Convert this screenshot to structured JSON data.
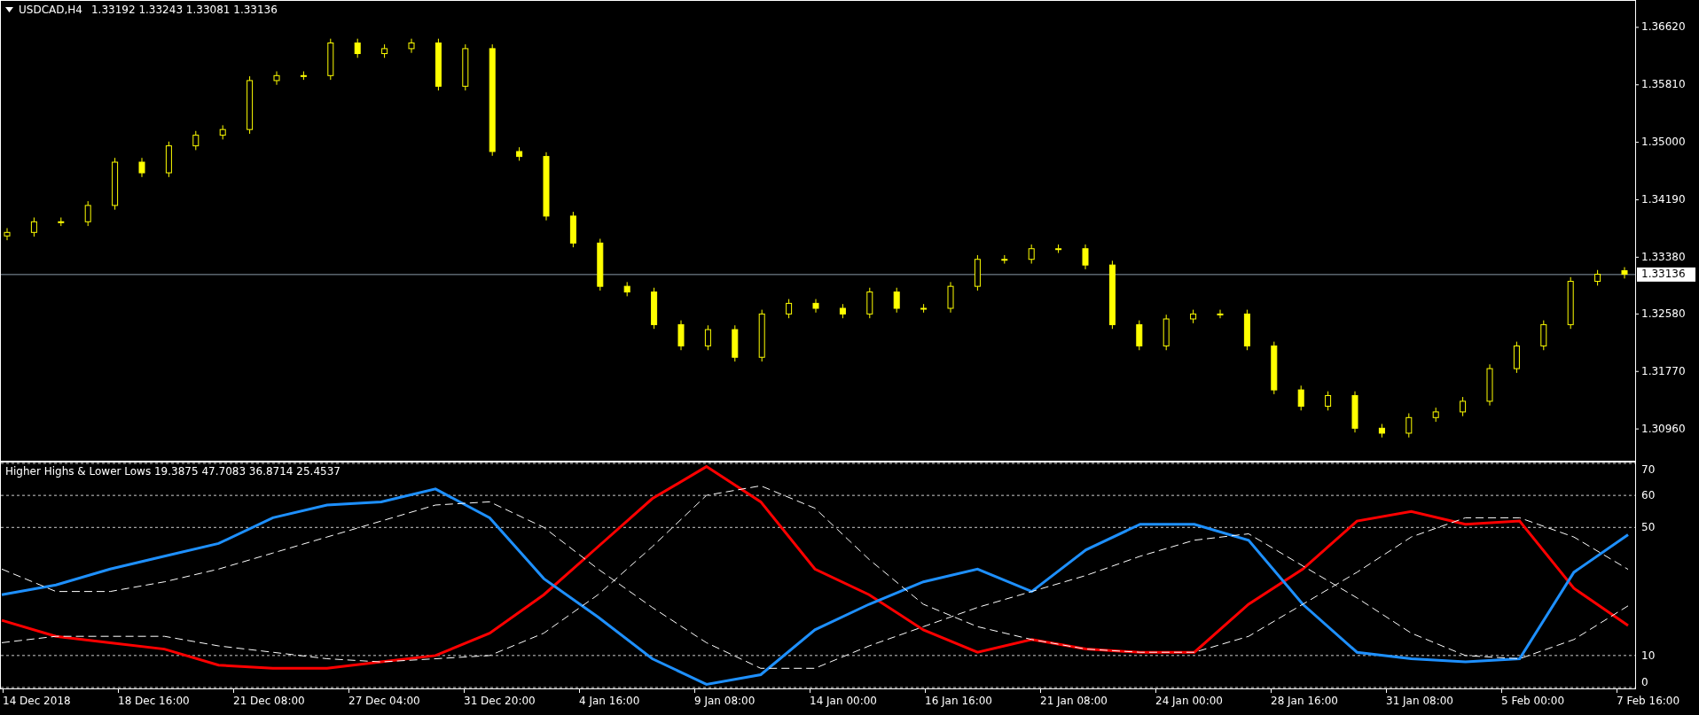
{
  "price_panel": {
    "symbol": "USDCAD,H4",
    "quote": "1.33192 1.33243 1.33081 1.33136",
    "chart_data": {
      "type": "candlestick",
      "ylim": [
        1.30537,
        1.36968
      ],
      "yticks": [
        {
          "value": 1.3662,
          "label": "1.36620"
        },
        {
          "value": 1.3581,
          "label": "1.35810"
        },
        {
          "value": 1.35,
          "label": "1.35000"
        },
        {
          "value": 1.3419,
          "label": "1.34190"
        },
        {
          "value": 1.3338,
          "label": "1.33380"
        },
        {
          "value": 1.3258,
          "label": "1.32580"
        },
        {
          "value": 1.3177,
          "label": "1.31770"
        },
        {
          "value": 1.3096,
          "label": "1.30960"
        }
      ],
      "ref_lines": [
        {
          "axis": "y",
          "value": 1.33136,
          "label": "1.33136",
          "color": "#8a9aa8"
        }
      ],
      "color": "#ffff00",
      "categories": [
        null,
        null,
        null,
        null,
        null,
        null,
        null,
        null,
        null,
        null,
        null,
        null,
        null,
        null,
        null,
        null,
        null,
        null,
        null,
        null,
        null,
        null,
        null,
        null,
        null,
        null,
        null,
        null,
        null,
        null,
        null,
        null,
        null,
        null,
        null,
        null,
        null,
        null,
        null,
        null,
        null,
        null,
        null,
        null,
        null,
        null,
        null,
        null,
        null,
        null,
        null,
        null,
        null,
        null,
        null,
        null,
        null,
        null,
        null,
        null,
        null
      ],
      "ohlc": [
        [
          1.3368,
          1.3379,
          1.3362,
          1.3373
        ],
        [
          1.3373,
          1.3394,
          1.3367,
          1.3388
        ],
        [
          1.3388,
          1.3394,
          1.3382,
          1.3388
        ],
        [
          1.3388,
          1.3417,
          1.3382,
          1.3411
        ],
        [
          1.3411,
          1.3478,
          1.3405,
          1.3472
        ],
        [
          1.3472,
          1.3478,
          1.3451,
          1.3457
        ],
        [
          1.3457,
          1.3501,
          1.3451,
          1.3495
        ],
        [
          1.3495,
          1.3516,
          1.3489,
          1.351
        ],
        [
          1.351,
          1.3524,
          1.3504,
          1.3518
        ],
        [
          1.3518,
          1.3593,
          1.3512,
          1.3587
        ],
        [
          1.3587,
          1.36,
          1.3581,
          1.3594
        ],
        [
          1.3594,
          1.36,
          1.3588,
          1.3594
        ],
        [
          1.3594,
          1.3646,
          1.3588,
          1.364
        ],
        [
          1.364,
          1.3646,
          1.3619,
          1.3625
        ],
        [
          1.3625,
          1.3638,
          1.3619,
          1.3632
        ],
        [
          1.3632,
          1.3646,
          1.3626,
          1.364
        ],
        [
          1.364,
          1.3646,
          1.3573,
          1.3579
        ],
        [
          1.3579,
          1.3638,
          1.3573,
          1.3632
        ],
        [
          1.3632,
          1.3638,
          1.3481,
          1.3487
        ],
        [
          1.3487,
          1.3493,
          1.3474,
          1.348
        ],
        [
          1.348,
          1.3486,
          1.339,
          1.3396
        ],
        [
          1.3396,
          1.3402,
          1.3352,
          1.3358
        ],
        [
          1.3358,
          1.3364,
          1.3291,
          1.3297
        ],
        [
          1.3297,
          1.3303,
          1.3283,
          1.3289
        ],
        [
          1.3289,
          1.3295,
          1.3237,
          1.3243
        ],
        [
          1.3243,
          1.3249,
          1.3207,
          1.3213
        ],
        [
          1.3213,
          1.3242,
          1.3207,
          1.3236
        ],
        [
          1.3236,
          1.3242,
          1.3191,
          1.3197
        ],
        [
          1.3197,
          1.3264,
          1.3191,
          1.3258
        ],
        [
          1.3258,
          1.3279,
          1.3252,
          1.3273
        ],
        [
          1.3273,
          1.3279,
          1.326,
          1.3266
        ],
        [
          1.3266,
          1.3272,
          1.3252,
          1.3258
        ],
        [
          1.3258,
          1.3295,
          1.3252,
          1.3289
        ],
        [
          1.3289,
          1.3295,
          1.326,
          1.3266
        ],
        [
          1.3266,
          1.3272,
          1.326,
          1.3266
        ],
        [
          1.3266,
          1.3303,
          1.326,
          1.3297
        ],
        [
          1.3297,
          1.3341,
          1.3291,
          1.3335
        ],
        [
          1.3335,
          1.3341,
          1.3329,
          1.3335
        ],
        [
          1.3335,
          1.3356,
          1.3329,
          1.335
        ],
        [
          1.335,
          1.3356,
          1.3344,
          1.335
        ],
        [
          1.335,
          1.3356,
          1.3321,
          1.3327
        ],
        [
          1.3327,
          1.3333,
          1.3237,
          1.3243
        ],
        [
          1.3243,
          1.3249,
          1.3207,
          1.3213
        ],
        [
          1.3213,
          1.3257,
          1.3207,
          1.3251
        ],
        [
          1.3251,
          1.3264,
          1.3245,
          1.3258
        ],
        [
          1.3258,
          1.3264,
          1.3252,
          1.3258
        ],
        [
          1.3258,
          1.3264,
          1.3207,
          1.3213
        ],
        [
          1.3213,
          1.3219,
          1.3145,
          1.3151
        ],
        [
          1.3151,
          1.3157,
          1.3122,
          1.3128
        ],
        [
          1.3128,
          1.3149,
          1.3122,
          1.3143
        ],
        [
          1.3143,
          1.3149,
          1.3091,
          1.3097
        ],
        [
          1.3097,
          1.3103,
          1.3084,
          1.309
        ],
        [
          1.309,
          1.3118,
          1.3084,
          1.3112
        ],
        [
          1.3112,
          1.3126,
          1.3106,
          1.312
        ],
        [
          1.312,
          1.3141,
          1.3114,
          1.3135
        ],
        [
          1.3135,
          1.3187,
          1.3129,
          1.3181
        ],
        [
          1.3181,
          1.3219,
          1.3175,
          1.3213
        ],
        [
          1.3213,
          1.3249,
          1.3207,
          1.3243
        ],
        [
          1.3243,
          1.331,
          1.3237,
          1.3304
        ],
        [
          1.3304,
          1.332,
          1.3298,
          1.3314
        ],
        [
          1.3319,
          1.3324,
          1.3308,
          1.3314
        ]
      ]
    }
  },
  "indicator_panel": {
    "title": "Higher Highs & Lower Lows 19.3875 47.7083 36.8714 25.4537",
    "chart_data": {
      "type": "line",
      "ylim": [
        0,
        70
      ],
      "yticks": [
        70,
        60,
        50,
        10,
        0
      ],
      "grid": true,
      "series": [
        {
          "color": "#ff0000",
          "line_style": "solid",
          "values": [
            21,
            16,
            14,
            12,
            7,
            6,
            6,
            8,
            10,
            17,
            29,
            44,
            59,
            69,
            58,
            37,
            29,
            18,
            11,
            15,
            12,
            11,
            11,
            26,
            37,
            52,
            55,
            51,
            52,
            31,
            19.4
          ]
        },
        {
          "color": "#1e90ff",
          "line_style": "solid",
          "values": [
            29,
            32,
            37,
            41,
            45,
            53,
            57,
            58,
            62,
            53,
            34,
            22,
            9,
            1,
            4,
            18,
            26,
            33,
            37,
            30,
            43,
            51,
            51,
            46,
            26,
            11,
            9,
            8,
            9,
            36,
            47.7
          ]
        },
        {
          "color": "#ffffff",
          "line_style": "dashed",
          "values": [
            14,
            16,
            16,
            16,
            13,
            11,
            9,
            8,
            9,
            10,
            17,
            29,
            44,
            60,
            63,
            56,
            40,
            26,
            19,
            15,
            12,
            11,
            11,
            16,
            26,
            36,
            47,
            53,
            53,
            47,
            36.9
          ]
        },
        {
          "color": "#ffffff",
          "line_style": "dashed",
          "values": [
            37,
            30,
            30,
            33,
            37,
            42,
            47,
            52,
            57,
            58,
            50,
            37,
            25,
            14,
            6,
            6,
            13,
            19,
            25,
            30,
            35,
            41,
            46,
            48,
            38,
            28,
            17,
            10,
            9,
            15,
            25.5
          ]
        }
      ]
    }
  },
  "time_axis": [
    "14 Dec 2018",
    "18 Dec 16:00",
    "21 Dec 08:00",
    "27 Dec 04:00",
    "31 Dec 20:00",
    "4 Jan 16:00",
    "9 Jan 08:00",
    "14 Jan 00:00",
    "16 Jan 16:00",
    "21 Jan 08:00",
    "24 Jan 00:00",
    "28 Jan 16:00",
    "31 Jan 08:00",
    "5 Feb 00:00",
    "7 Feb 16:00"
  ]
}
